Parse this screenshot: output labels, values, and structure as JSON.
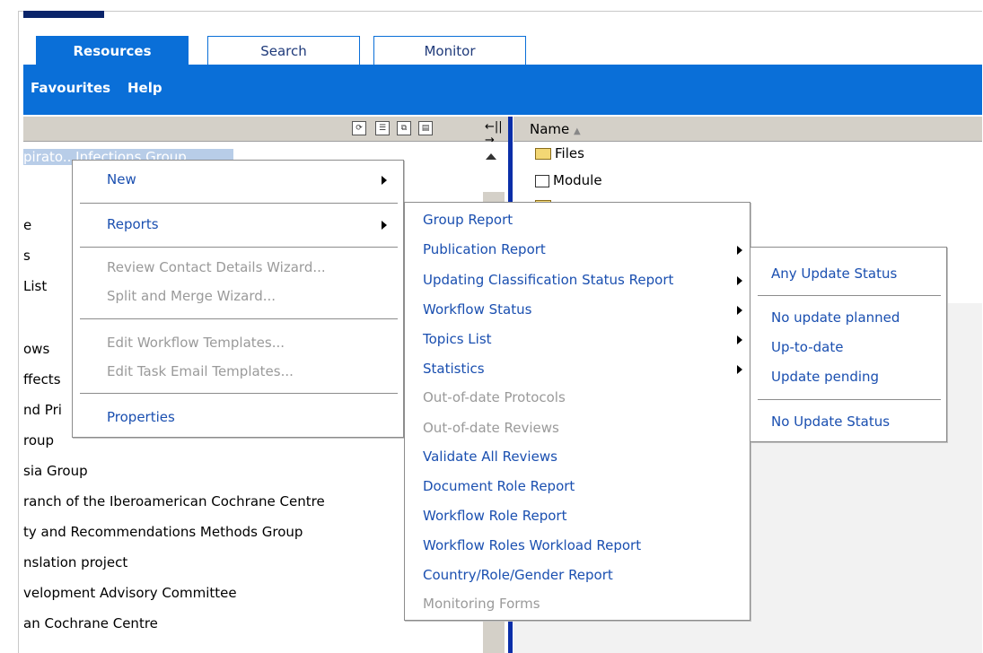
{
  "tabs": [
    {
      "label": "Resources",
      "active": true
    },
    {
      "label": "Search",
      "active": false
    },
    {
      "label": "Monitor",
      "active": false
    }
  ],
  "menubar": {
    "favourites": "Favourites",
    "help": "Help"
  },
  "tree": {
    "rows": [
      "pirato...Infections Group",
      "e",
      "s",
      " List",
      "ows",
      "ffects",
      "nd Pri",
      "roup",
      "sia Group",
      "ranch of the Iberoamerican Cochrane Centre",
      "ty and Recommendations Methods Group",
      "nslation project",
      "velopment Advisory Committee",
      "an Cochrane Centre"
    ]
  },
  "right_panel": {
    "column_header": "Name",
    "items": [
      "Files",
      "Module"
    ]
  },
  "context_menu": {
    "items": [
      {
        "label": "New",
        "enabled": true,
        "submenu": true
      },
      {
        "label": "Reports",
        "enabled": true,
        "submenu": true
      },
      {
        "label": "Review Contact Details Wizard...",
        "enabled": false
      },
      {
        "label": "Split and Merge Wizard...",
        "enabled": false
      },
      {
        "label": "Edit Workflow Templates...",
        "enabled": false
      },
      {
        "label": "Edit Task Email Templates...",
        "enabled": false
      },
      {
        "label": "Properties",
        "enabled": true
      }
    ]
  },
  "reports_menu": {
    "items": [
      {
        "label": "Group Report",
        "enabled": true,
        "submenu": false
      },
      {
        "label": "Publication Report",
        "enabled": true,
        "submenu": true
      },
      {
        "label": "Updating Classification Status Report",
        "enabled": true,
        "submenu": true
      },
      {
        "label": "Workflow Status",
        "enabled": true,
        "submenu": true
      },
      {
        "label": "Topics List",
        "enabled": true,
        "submenu": true
      },
      {
        "label": "Statistics",
        "enabled": true,
        "submenu": true
      },
      {
        "label": "Out-of-date Protocols",
        "enabled": false
      },
      {
        "label": "Out-of-date Reviews",
        "enabled": false
      },
      {
        "label": "Validate All Reviews",
        "enabled": true
      },
      {
        "label": "Document Role Report",
        "enabled": true
      },
      {
        "label": "Workflow Role Report",
        "enabled": true
      },
      {
        "label": "Workflow Roles Workload Report",
        "enabled": true
      },
      {
        "label": "Country/Role/Gender Report",
        "enabled": true
      },
      {
        "label": "Monitoring Forms",
        "enabled": false
      }
    ]
  },
  "status_menu": {
    "items": [
      {
        "label": "Any Update Status"
      },
      {
        "label": "No update planned"
      },
      {
        "label": "Up-to-date"
      },
      {
        "label": "Update pending"
      },
      {
        "label": "No Update Status"
      }
    ]
  },
  "colors": {
    "accent": "#0a6fd8",
    "link": "#1a4fb0",
    "disabled": "#9a9a9a",
    "selection": "#b8cde8"
  }
}
